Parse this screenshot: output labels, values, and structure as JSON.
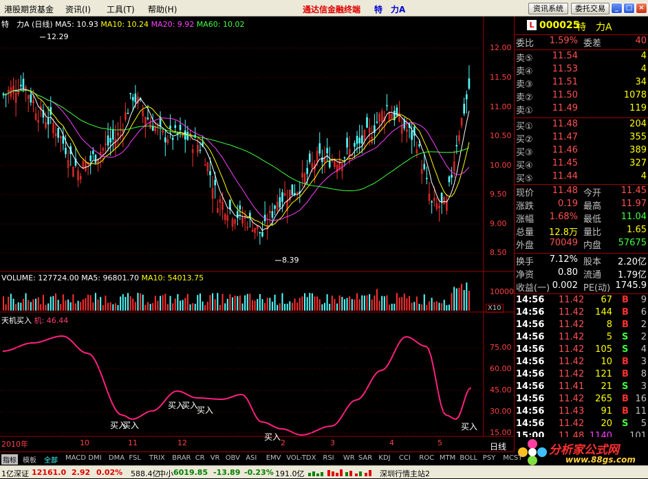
{
  "menu": {
    "items": [
      "港股期货基金",
      "资讯(I)",
      "工具(T)",
      "帮助(H)"
    ],
    "title": "通达信金融终端",
    "title_suffix": "特　力A",
    "btn_news": "资讯系统",
    "btn_trade": "委托交易"
  },
  "chart": {
    "header": {
      "name": "特　力A",
      "period": "(日线)",
      "ma5": "MA5: 10.93",
      "ma10": "MA10: 10.24",
      "ma20": "MA20: 9.92",
      "ma60": "MA60: 10.02"
    },
    "high_label": "12.29",
    "low_label": "8.39",
    "price_ticks": [
      "12.00",
      "11.50",
      "11.00",
      "10.50",
      "10.00",
      "9.50",
      "9.00",
      "8.50"
    ],
    "volume_header": {
      "label": "VOLUME: 127724.00",
      "ma5": "MA5: 96801.70",
      "ma10": "MA10: 54013.75"
    },
    "vol_tick": "10000",
    "vol_unit": "X10",
    "ind_header": {
      "label": "天机买入",
      "sub": "机: 46.44"
    },
    "ind_ticks": [
      "75.00",
      "60.00",
      "45.00",
      "30.00",
      "15.00"
    ],
    "buy_marks": [
      "买入",
      "买入",
      "买入",
      "买入",
      "买入",
      "买入",
      "买入"
    ],
    "date_labels": [
      "2010年",
      "10",
      "11",
      "12",
      "2",
      "3",
      "4",
      "5"
    ],
    "period_label": "日线"
  },
  "quote": {
    "code": "000025",
    "name": "特　力A",
    "badge": "L",
    "weibi_label": "委比",
    "weibi": "1.59%",
    "weicha_label": "委差",
    "weicha": "40",
    "sells": [
      {
        "l": "卖⑤",
        "p": "11.54",
        "v": "4"
      },
      {
        "l": "卖④",
        "p": "11.53",
        "v": "4"
      },
      {
        "l": "卖③",
        "p": "11.51",
        "v": "34"
      },
      {
        "l": "卖②",
        "p": "11.50",
        "v": "1078"
      },
      {
        "l": "卖①",
        "p": "11.49",
        "v": "119"
      }
    ],
    "buys": [
      {
        "l": "买①",
        "p": "11.48",
        "v": "204"
      },
      {
        "l": "买②",
        "p": "11.47",
        "v": "355"
      },
      {
        "l": "买③",
        "p": "11.46",
        "v": "389"
      },
      {
        "l": "买④",
        "p": "11.45",
        "v": "327"
      },
      {
        "l": "买⑤",
        "p": "11.44",
        "v": "4"
      }
    ],
    "stats": [
      {
        "a": "现价",
        "av": "11.48",
        "b": "今开",
        "bv": "11.45",
        "ac": "#ff5050",
        "bc": "#ff5050"
      },
      {
        "a": "涨跌",
        "av": "0.19",
        "b": "最高",
        "bv": "11.97",
        "ac": "#ff5050",
        "bc": "#ff5050"
      },
      {
        "a": "涨幅",
        "av": "1.68%",
        "b": "最低",
        "bv": "11.04",
        "ac": "#ff5050",
        "bc": "#40ff40"
      },
      {
        "a": "总量",
        "av": "12.8万",
        "b": "量比",
        "bv": "1.65",
        "ac": "#ffff00",
        "bc": "#ffff00"
      },
      {
        "a": "外盘",
        "av": "70049",
        "b": "内盘",
        "bv": "57675",
        "ac": "#ff5050",
        "bc": "#40ff40"
      }
    ],
    "stats2": [
      {
        "a": "换手",
        "av": "7.12%",
        "b": "股本",
        "bv": "2.20亿"
      },
      {
        "a": "净资",
        "av": "0.80",
        "b": "流通",
        "bv": "1.79亿"
      },
      {
        "a": "收益(一)",
        "av": "0.002",
        "b": "PE(动)",
        "bv": "1745.9"
      }
    ],
    "ticks": [
      {
        "t": "14:56",
        "p": "11.42",
        "v": "67",
        "bs": "B",
        "n": "9"
      },
      {
        "t": "14:56",
        "p": "11.42",
        "v": "144",
        "bs": "B",
        "n": "6"
      },
      {
        "t": "14:56",
        "p": "11.42",
        "v": "8",
        "bs": "B",
        "n": "2"
      },
      {
        "t": "14:56",
        "p": "11.42",
        "v": "5",
        "bs": "S",
        "n": "2"
      },
      {
        "t": "14:56",
        "p": "11.42",
        "v": "105",
        "bs": "S",
        "n": "4"
      },
      {
        "t": "14:56",
        "p": "11.42",
        "v": "10",
        "bs": "B",
        "n": "3"
      },
      {
        "t": "14:56",
        "p": "11.42",
        "v": "121",
        "bs": "B",
        "n": "8"
      },
      {
        "t": "14:56",
        "p": "11.41",
        "v": "21",
        "bs": "S",
        "n": "3"
      },
      {
        "t": "14:56",
        "p": "11.42",
        "v": "265",
        "bs": "B",
        "n": "16"
      },
      {
        "t": "14:56",
        "p": "11.43",
        "v": "91",
        "bs": "B",
        "n": "11"
      },
      {
        "t": "14:56",
        "p": "11.42",
        "v": "20",
        "bs": "S",
        "n": "5"
      },
      {
        "t": "15:00",
        "p": "11.48",
        "v": "1140",
        "bs": "",
        "n": "101"
      }
    ]
  },
  "tabs": [
    "指标",
    "模板",
    "全部",
    "MACD",
    "DMI",
    "DMA",
    "FSL",
    "TRIX",
    "BRAR",
    "CR",
    "VR",
    "OBV",
    "ASI",
    "EMV",
    "VOL-TDX",
    "RSI",
    "WR",
    "SAR",
    "KDJ",
    "CCI",
    "ROC",
    "MTM",
    "BOLL",
    "PSY",
    "MCST"
  ],
  "status": {
    "a": "1亿",
    "b": "深证",
    "c": "12161.0",
    "d": "2.92",
    "e": "0.02%",
    "f": "588.4亿",
    "g": "中小",
    "h": "6019.85",
    "i": "-13.89",
    "j": "-0.23%",
    "k": "191.0亿",
    "l": "深圳行情主站2"
  },
  "logo": {
    "text": "分析家公式网",
    "url": "www.88gs.com"
  }
}
